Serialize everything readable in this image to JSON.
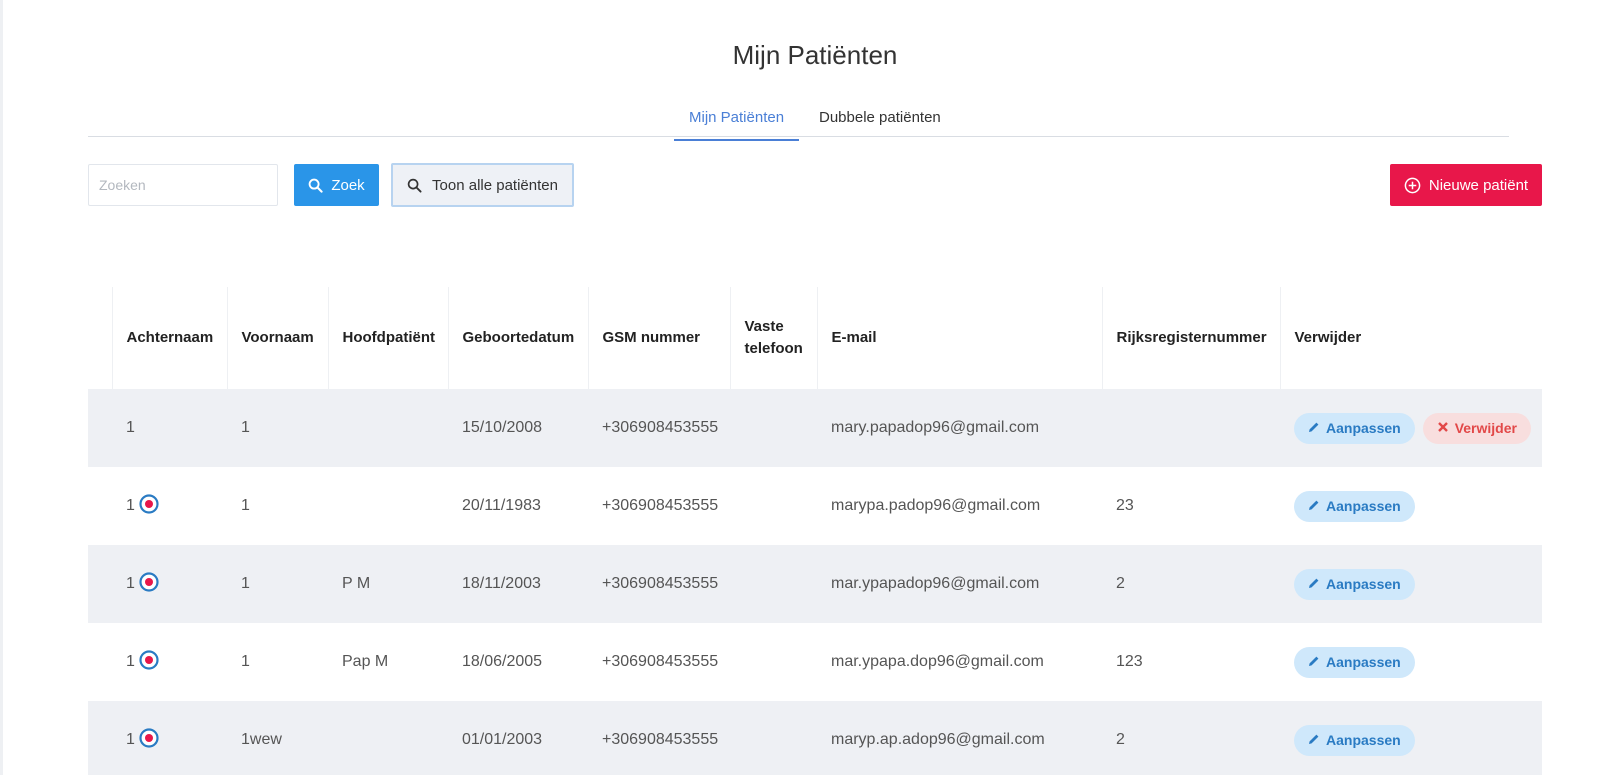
{
  "page": {
    "title": "Mijn Patiënten"
  },
  "tabs": [
    {
      "label": "Mijn Patiënten",
      "active": true
    },
    {
      "label": "Dubbele patiënten",
      "active": false
    }
  ],
  "search": {
    "placeholder": "Zoeken",
    "value": ""
  },
  "buttons": {
    "search": "Zoek",
    "show_all": "Toon alle patiënten",
    "new_patient": "Nieuwe patiënt"
  },
  "table": {
    "headers": [
      "",
      "Achternaam",
      "Voornaam",
      "Hoofdpatiënt",
      "Geboortedatum",
      "GSM nummer",
      "Vaste telefoon",
      "E-mail",
      "Rijksregisternummer",
      "Verwijder"
    ],
    "rows": [
      {
        "lastname": "1",
        "icon": false,
        "firstname": "1",
        "main": "",
        "dob": "15/10/2008",
        "gsm": "+306908453555",
        "phone": "",
        "email": "mary.papadop96@gmail.com",
        "rrn": "",
        "edit": "Aanpassen",
        "delete": "Verwijder"
      },
      {
        "lastname": "1",
        "icon": true,
        "firstname": "1",
        "main": "",
        "dob": "20/11/1983",
        "gsm": "+306908453555",
        "phone": "",
        "email": "marypa.padop96@gmail.com",
        "rrn": "23",
        "edit": "Aanpassen",
        "delete": ""
      },
      {
        "lastname": "1",
        "icon": true,
        "firstname": "1",
        "main": "P M",
        "dob": "18/11/2003",
        "gsm": "+306908453555",
        "phone": "",
        "email": "mar.ypapadop96@gmail.com",
        "rrn": "2",
        "edit": "Aanpassen",
        "delete": ""
      },
      {
        "lastname": "1",
        "icon": true,
        "firstname": "1",
        "main": "Pap M",
        "dob": "18/06/2005",
        "gsm": "+306908453555",
        "phone": "",
        "email": "mar.ypapa.dop96@gmail.com",
        "rrn": "123",
        "edit": "Aanpassen",
        "delete": ""
      },
      {
        "lastname": "1",
        "icon": true,
        "firstname": "1wew",
        "main": "",
        "dob": "01/01/2003",
        "gsm": "+306908453555",
        "phone": "",
        "email": "maryp.ap.adop96@gmail.com",
        "rrn": "2",
        "edit": "Aanpassen",
        "delete": ""
      }
    ]
  },
  "colors": {
    "accent": "#4a7fd6",
    "primary": "#2a95e8",
    "danger": "#e8174a",
    "row_alt": "#eef0f4"
  }
}
